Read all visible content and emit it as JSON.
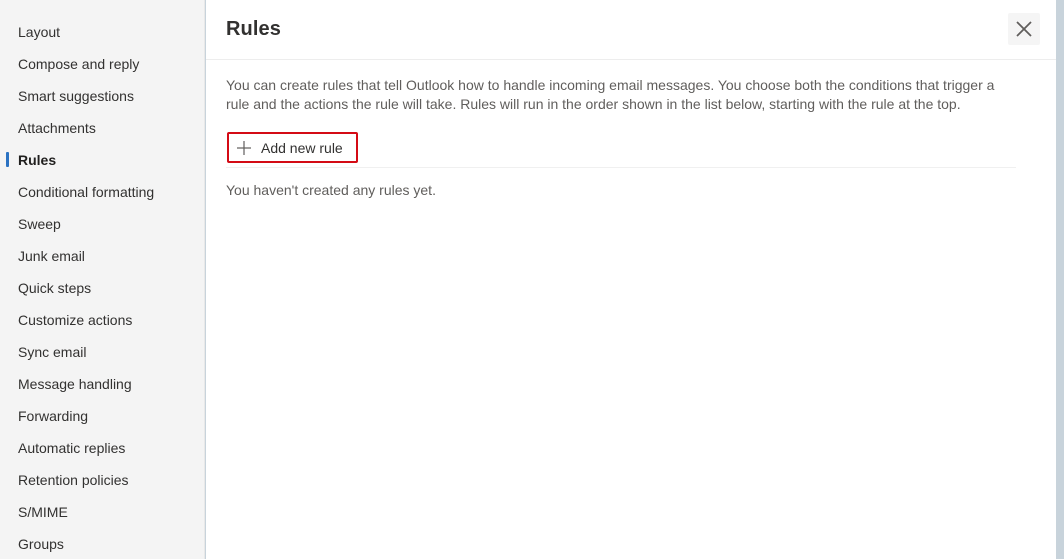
{
  "sidebar": {
    "active_index": 4,
    "items": [
      {
        "label": "Layout"
      },
      {
        "label": "Compose and reply"
      },
      {
        "label": "Smart suggestions"
      },
      {
        "label": "Attachments"
      },
      {
        "label": "Rules"
      },
      {
        "label": "Conditional formatting"
      },
      {
        "label": "Sweep"
      },
      {
        "label": "Junk email"
      },
      {
        "label": "Quick steps"
      },
      {
        "label": "Customize actions"
      },
      {
        "label": "Sync email"
      },
      {
        "label": "Message handling"
      },
      {
        "label": "Forwarding"
      },
      {
        "label": "Automatic replies"
      },
      {
        "label": "Retention policies"
      },
      {
        "label": "S/MIME"
      },
      {
        "label": "Groups"
      }
    ]
  },
  "main": {
    "title": "Rules",
    "close_icon": "close-icon",
    "description": "You can create rules that tell Outlook how to handle incoming email messages. You choose both the conditions that trigger a rule and the actions the rule will take. Rules will run in the order shown in the list below, starting with the rule at the top.",
    "add_rule": {
      "icon": "plus-icon",
      "label": "Add new rule",
      "highlight_color": "#d40b15"
    },
    "empty_message": "You haven't created any rules yet."
  },
  "colors": {
    "accent": "#2b72c2",
    "sidebar_bg": "#f4f4f4",
    "highlight": "#d40b15"
  }
}
